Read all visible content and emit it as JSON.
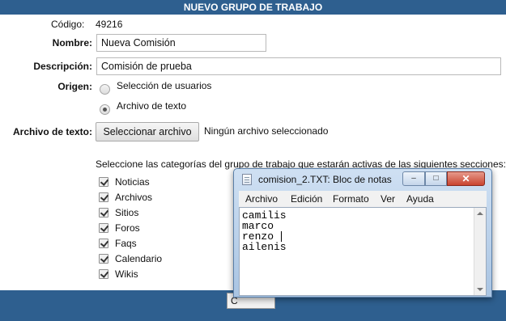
{
  "header": {
    "title": "NUEVO GRUPO DE TRABAJO"
  },
  "form": {
    "codigo_label": "Código:",
    "codigo_value": "49216",
    "nombre_label": "Nombre:",
    "nombre_value": "Nueva Comisión",
    "descripcion_label": "Descripción:",
    "descripcion_value": "Comisión de prueba",
    "origen_label": "Origen:",
    "origen_options": [
      {
        "label": "Selección de usuarios",
        "checked": false
      },
      {
        "label": "Archivo de texto",
        "checked": true
      }
    ],
    "archivo_label": "Archivo de texto:",
    "archivo_button": "Seleccionar archivo",
    "archivo_status": "Ningún archivo seleccionado",
    "categorias_intro": "Seleccione las categorías del grupo de trabajo que estarán activas de las siguientes secciones:",
    "categorias": [
      {
        "label": "Noticias",
        "checked": true
      },
      {
        "label": "Archivos",
        "checked": true
      },
      {
        "label": "Sitios",
        "checked": true
      },
      {
        "label": "Foros",
        "checked": true
      },
      {
        "label": "Faqs",
        "checked": true
      },
      {
        "label": "Calendario",
        "checked": true
      },
      {
        "label": "Wikis",
        "checked": true
      }
    ]
  },
  "footer": {
    "button_partial": "C"
  },
  "notepad": {
    "title": "comision_2.TXT: Bloc de notas",
    "controls": {
      "minimize": "–",
      "maximize": "□",
      "close": "✕"
    },
    "menu": [
      "Archivo",
      "Edición",
      "Formato",
      "Ver",
      "Ayuda"
    ],
    "lines": [
      "camilis",
      "marco",
      "renzo",
      "ailenis"
    ]
  },
  "colors": {
    "header_bg": "#2e5f8f",
    "footer_bg": "#2e5f8f",
    "notepad_frame": "#a9c4e2",
    "close_button": "#c94430"
  }
}
